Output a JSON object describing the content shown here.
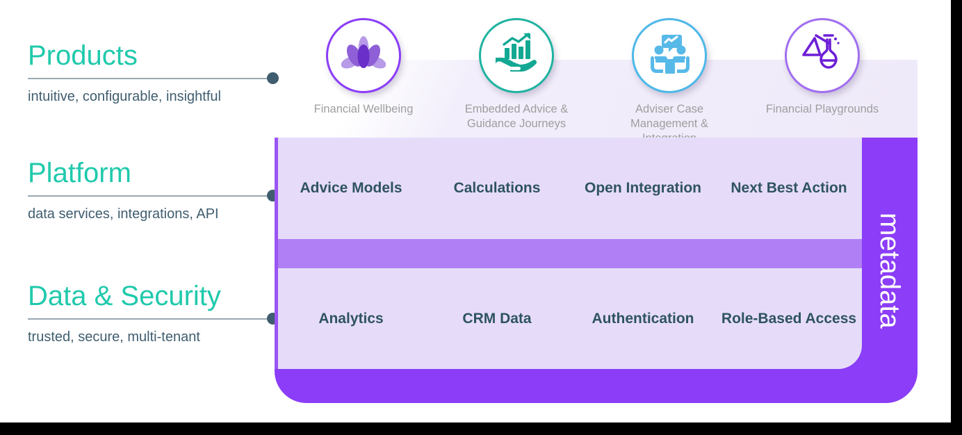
{
  "theme": {
    "accent_teal": "#20c9ac",
    "text_slate": "#3f5d6f",
    "tier_text": "#2f5360",
    "purple_strong": "#8b3df7",
    "purple_mid": "#b07ff5",
    "purple_light": "#e6dcfa",
    "lavender_backdrop": "#efeaf9",
    "icon_label_gray": "#9e9e9e",
    "connector_line": "#9aa7b0"
  },
  "layers": [
    {
      "title": "Products",
      "subtitle": "intuitive, configurable, insightful",
      "connector": "layer-connector-dot"
    },
    {
      "title": "Platform",
      "subtitle": "data services, integrations, API",
      "connector": "layer-connector-dot"
    },
    {
      "title": "Data & Security",
      "subtitle": "trusted, secure, multi-tenant",
      "connector": "layer-connector-dot"
    }
  ],
  "products": [
    {
      "label": "Financial Wellbeing",
      "icon": "lotus-flower-icon",
      "ring_color": "#8b3df7",
      "icon_color": "#8b3df7"
    },
    {
      "label": "Embedded Advice & Guidance Journeys",
      "icon": "hand-holding-growth-chart-icon",
      "ring_color": "#1fb3a0",
      "icon_color": "#13a893"
    },
    {
      "label": "Adviser Case Management & Integration",
      "icon": "two-people-meeting-icon",
      "ring_color": "#4db8e8",
      "icon_color": "#57b9e8"
    },
    {
      "label": "Financial Playgrounds",
      "icon": "lab-flasks-icon",
      "ring_color": "#8b3df7",
      "icon_color": "#6d1fd6"
    }
  ],
  "stack": {
    "platform_row": [
      "Advice Models",
      "Calculations",
      "Open Integration",
      "Next Best Action"
    ],
    "data_row": [
      "Analytics",
      "CRM Data",
      "Authentication",
      "Role-Based Access"
    ],
    "metadata_label": "metadata"
  }
}
